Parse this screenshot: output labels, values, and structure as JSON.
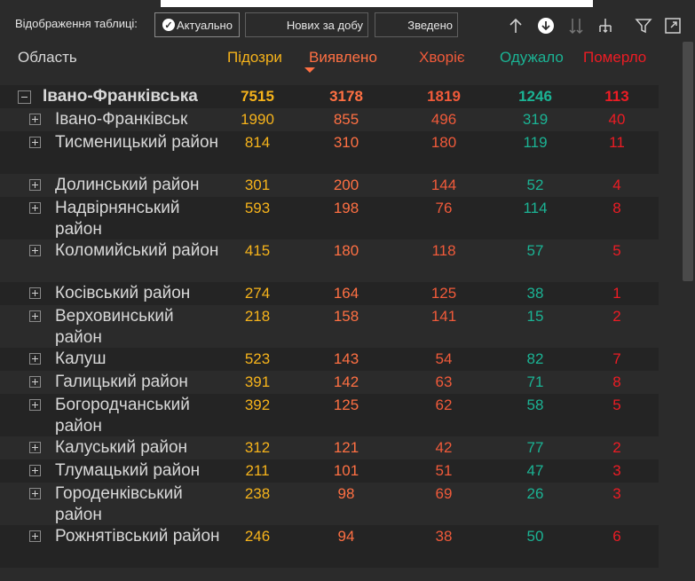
{
  "toolbar": {
    "label": "Відображення таблиці:",
    "btn_actual": "Актуально",
    "btn_new": "Нових за добу",
    "btn_summary": "Зведено"
  },
  "columns": {
    "region": "Область",
    "suspected": "Підозри",
    "detected": "Виявлено",
    "sick": "Хворіє",
    "recovered": "Одужало",
    "died": "Померло"
  },
  "colors": {
    "suspected": "#f6b31b",
    "detected": "#ff7043",
    "sick": "#f05a3a",
    "recovered": "#1bb394",
    "died": "#ed1c24"
  },
  "group": {
    "name": "Івано-Франківська",
    "suspected": "7515",
    "detected": "3178",
    "sick": "1819",
    "recovered": "1246",
    "died": "113"
  },
  "rows": [
    {
      "name": "Івано-Франківськ",
      "suspected": "1990",
      "detected": "855",
      "sick": "496",
      "recovered": "319",
      "died": "40"
    },
    {
      "name": "Тисменицький район",
      "suspected": "814",
      "detected": "310",
      "sick": "180",
      "recovered": "119",
      "died": "11"
    },
    {
      "name": "Долинський район",
      "suspected": "301",
      "detected": "200",
      "sick": "144",
      "recovered": "52",
      "died": "4"
    },
    {
      "name": "Надвірнянський район",
      "suspected": "593",
      "detected": "198",
      "sick": "76",
      "recovered": "114",
      "died": "8"
    },
    {
      "name": "Коломийський район",
      "suspected": "415",
      "detected": "180",
      "sick": "118",
      "recovered": "57",
      "died": "5"
    },
    {
      "name": "Косівський район",
      "suspected": "274",
      "detected": "164",
      "sick": "125",
      "recovered": "38",
      "died": "1"
    },
    {
      "name": "Верховинський район",
      "suspected": "218",
      "detected": "158",
      "sick": "141",
      "recovered": "15",
      "died": "2"
    },
    {
      "name": "Калуш",
      "suspected": "523",
      "detected": "143",
      "sick": "54",
      "recovered": "82",
      "died": "7"
    },
    {
      "name": "Галицький район",
      "suspected": "391",
      "detected": "142",
      "sick": "63",
      "recovered": "71",
      "died": "8"
    },
    {
      "name": "Богородчанський район",
      "suspected": "392",
      "detected": "125",
      "sick": "62",
      "recovered": "58",
      "died": "5"
    },
    {
      "name": "Калуський район",
      "suspected": "312",
      "detected": "121",
      "sick": "42",
      "recovered": "77",
      "died": "2"
    },
    {
      "name": "Тлумацький район",
      "suspected": "211",
      "detected": "101",
      "sick": "51",
      "recovered": "47",
      "died": "3"
    },
    {
      "name": "Городенківський район",
      "suspected": "238",
      "detected": "98",
      "sick": "69",
      "recovered": "26",
      "died": "3"
    },
    {
      "name": "Рожнятівський район",
      "suspected": "246",
      "detected": "94",
      "sick": "38",
      "recovered": "50",
      "died": "6"
    }
  ]
}
